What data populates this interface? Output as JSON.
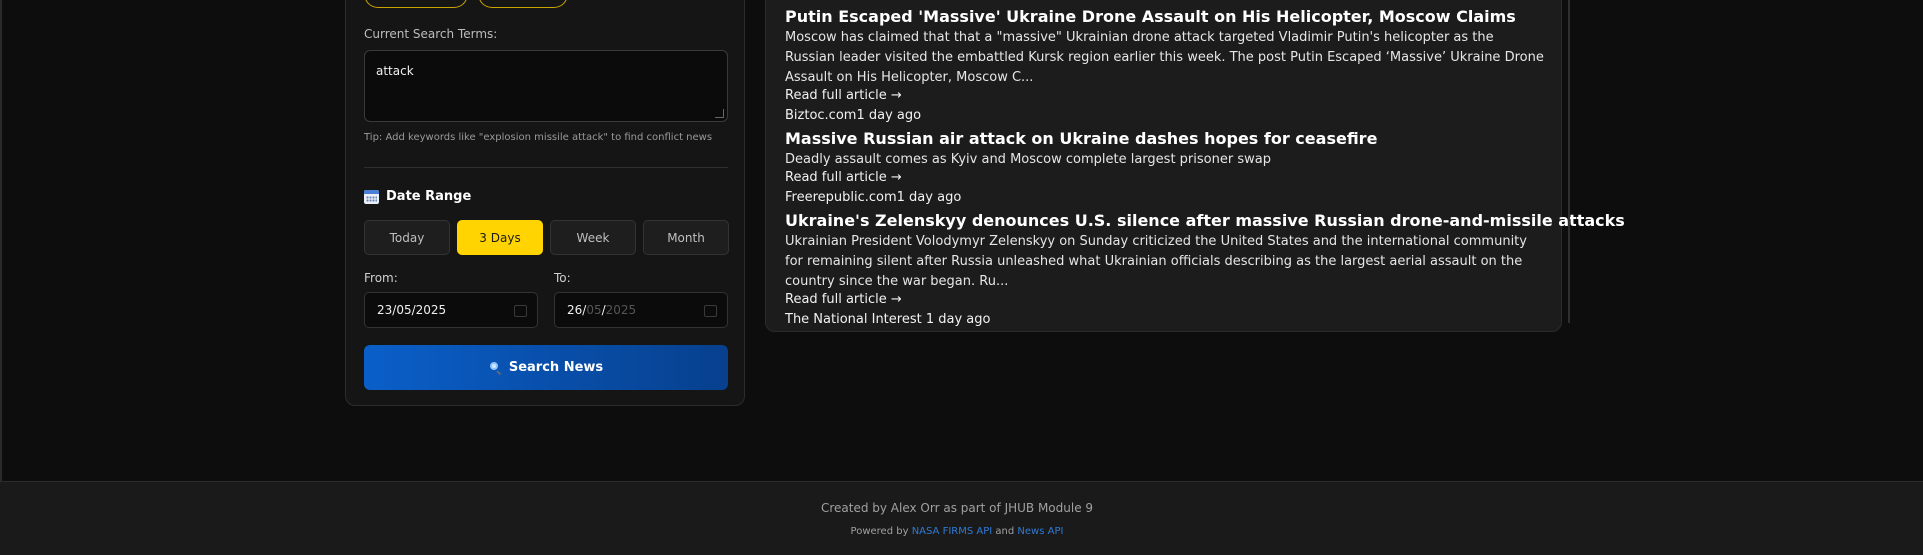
{
  "sidebar": {
    "search_terms_label": "Current Search Terms:",
    "search_terms_value": "attack",
    "tip": "Tip: Add keywords like \"explosion missile attack\" to find conflict news",
    "date_range_title": "Date Range",
    "date_range_icon": "calendar-icon",
    "range_options": [
      "Today",
      "3 Days",
      "Week",
      "Month"
    ],
    "range_selected": "3 Days",
    "from_label": "From:",
    "to_label": "To:",
    "from_value": "23/05/2025",
    "to_value_day": "26/",
    "to_value_month": "05",
    "to_value_sep": "/",
    "to_value_year": "2025",
    "search_button_label": "Search News",
    "search_button_icon": "magnifier-icon",
    "accent_color": "#ffd400",
    "button_color": "#0a5fc9"
  },
  "articles": [
    {
      "title": "Putin Escaped 'Massive' Ukraine Drone Assault on His Helicopter, Moscow Claims",
      "description": "Moscow has claimed that that a \"massive\" Ukrainian drone attack targeted Vladimir Putin's helicopter as the Russian leader visited the embattled Kursk region earlier this week. The post Putin Escaped ‘Massive’ Ukraine Drone Assault on His Helicopter, Moscow C...",
      "read_more": "Read full article →",
      "meta": "Biztoc.com1 day ago"
    },
    {
      "title": "Massive Russian air attack on Ukraine dashes hopes for ceasefire",
      "description": "Deadly assault comes as Kyiv and Moscow complete largest prisoner swap",
      "read_more": "Read full article →",
      "meta": "Freerepublic.com1 day ago"
    },
    {
      "title": "Ukraine's Zelenskyy denounces U.S. silence after massive Russian drone-and-missile attacks",
      "description": "Ukrainian President Volodymyr Zelenskyy on Sunday criticized the United States and the international community for remaining silent after Russia unleashed what Ukrainian officials describing as the largest aerial assault on the country since the war began. Ru...",
      "read_more": "Read full article →",
      "meta": "The National Interest 1 day ago"
    }
  ],
  "footer": {
    "credit": "Created by Alex Orr as part of JHUB Module 9",
    "powered_prefix": "Powered by",
    "link1": "NASA FIRMS API",
    "powered_and": "and",
    "link2": "News API"
  }
}
